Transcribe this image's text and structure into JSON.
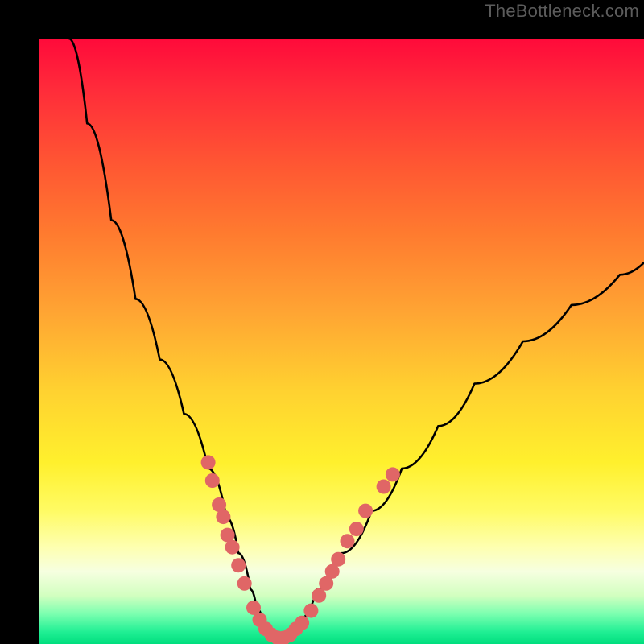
{
  "watermark": "TheBottleneck.com",
  "colors": {
    "frame": "#000000",
    "curve": "#000000",
    "marker": "#e06666",
    "gradient_top": "#ff0a3a",
    "gradient_bottom": "#00de7e"
  },
  "chart_data": {
    "type": "line",
    "title": "",
    "xlabel": "",
    "ylabel": "",
    "xlim": [
      0,
      100
    ],
    "ylim": [
      0,
      100
    ],
    "series": [
      {
        "name": "bottleneck-curve",
        "x": [
          5,
          8,
          12,
          16,
          20,
          24,
          28,
          31,
          33,
          35,
          36,
          37,
          38,
          39,
          40,
          41,
          43,
          46,
          50,
          55,
          60,
          66,
          72,
          80,
          88,
          96,
          100
        ],
        "y": [
          100,
          86,
          70,
          57,
          47,
          38,
          29,
          21,
          15,
          9,
          6,
          4,
          2,
          1,
          1,
          2,
          4,
          9,
          15,
          22,
          29,
          36,
          43,
          50,
          56,
          61,
          63
        ]
      }
    ],
    "markers": {
      "name": "highlighted-points",
      "points": [
        {
          "x": 28.0,
          "y": 30
        },
        {
          "x": 28.7,
          "y": 27
        },
        {
          "x": 29.8,
          "y": 23
        },
        {
          "x": 30.5,
          "y": 21
        },
        {
          "x": 31.2,
          "y": 18
        },
        {
          "x": 32.0,
          "y": 16
        },
        {
          "x": 33.0,
          "y": 13
        },
        {
          "x": 34.0,
          "y": 10
        },
        {
          "x": 35.5,
          "y": 6
        },
        {
          "x": 36.5,
          "y": 4
        },
        {
          "x": 37.5,
          "y": 2.5
        },
        {
          "x": 38.5,
          "y": 1.5
        },
        {
          "x": 39.5,
          "y": 1
        },
        {
          "x": 40.5,
          "y": 1
        },
        {
          "x": 41.5,
          "y": 1.5
        },
        {
          "x": 42.5,
          "y": 2.5
        },
        {
          "x": 43.5,
          "y": 3.5
        },
        {
          "x": 45.0,
          "y": 5.5
        },
        {
          "x": 46.3,
          "y": 8
        },
        {
          "x": 47.5,
          "y": 10
        },
        {
          "x": 48.5,
          "y": 12
        },
        {
          "x": 49.5,
          "y": 14
        },
        {
          "x": 51.0,
          "y": 17
        },
        {
          "x": 52.5,
          "y": 19
        },
        {
          "x": 54.0,
          "y": 22
        },
        {
          "x": 57.0,
          "y": 26
        },
        {
          "x": 58.5,
          "y": 28
        }
      ]
    }
  }
}
